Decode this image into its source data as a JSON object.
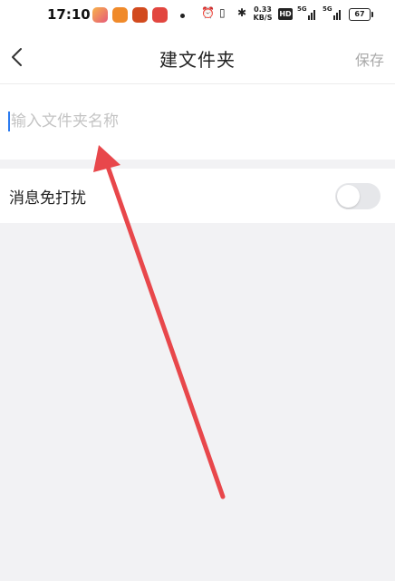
{
  "status_bar": {
    "time": "17:10",
    "net_speed_value": "0.33",
    "net_speed_unit": "KB/S",
    "hd_label": "HD",
    "sim1_label": "5G",
    "sim2_label": "5G",
    "battery": "67"
  },
  "nav": {
    "title": "建文件夹",
    "save_label": "保存"
  },
  "folder_name": {
    "value": "",
    "placeholder": "输入文件夹名称"
  },
  "settings": {
    "do_not_disturb_label": "消息免打扰",
    "do_not_disturb_on": false
  },
  "colors": {
    "accent_cursor": "#2b7bf0",
    "annotation_arrow": "#e8474b",
    "page_background": "#f2f2f4"
  }
}
